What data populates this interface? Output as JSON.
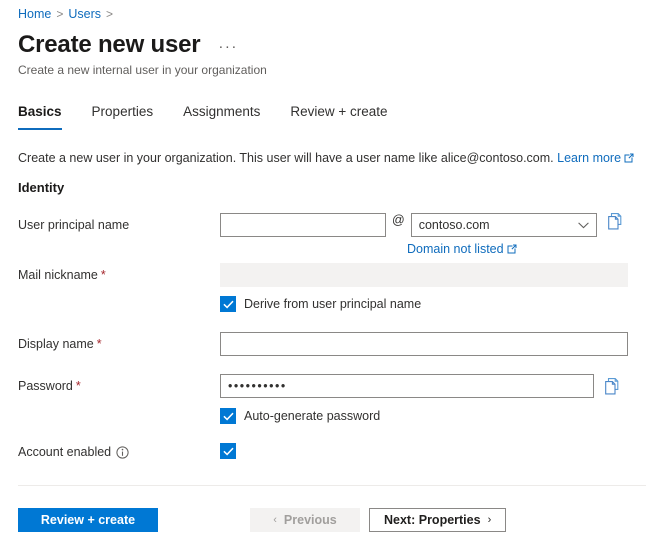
{
  "breadcrumb": {
    "items": [
      {
        "label": "Home"
      },
      {
        "label": "Users"
      }
    ],
    "separator": ">"
  },
  "header": {
    "title": "Create new user",
    "subtitle": "Create a new internal user in your organization",
    "more_menu": "···"
  },
  "tabs": [
    {
      "label": "Basics",
      "active": true
    },
    {
      "label": "Properties",
      "active": false
    },
    {
      "label": "Assignments",
      "active": false
    },
    {
      "label": "Review + create",
      "active": false
    }
  ],
  "intro": {
    "text": "Create a new user in your organization. This user will have a user name like alice@contoso.com.",
    "link_label": "Learn more",
    "link_icon": "external-link-icon"
  },
  "section": {
    "identity_heading": "Identity"
  },
  "fields": {
    "upn": {
      "label": "User principal name",
      "value": "",
      "placeholder": "",
      "at_sign": "@",
      "domain_value": "contoso.com",
      "domain_icon": "chevron-down-icon",
      "copy_icon": "copy-icon",
      "sublink_label": "Domain not listed",
      "sublink_icon": "external-link-icon"
    },
    "mail_nickname": {
      "label": "Mail nickname",
      "required": "*",
      "value": "",
      "disabled": true,
      "checkbox_label": "Derive from user principal name",
      "checkbox_checked": true
    },
    "display_name": {
      "label": "Display name",
      "required": "*",
      "value": "",
      "placeholder": ""
    },
    "password": {
      "label": "Password",
      "required": "*",
      "value": "••••••••••",
      "copy_icon": "copy-icon",
      "checkbox_label": "Auto-generate password",
      "checkbox_checked": true
    },
    "account_enabled": {
      "label": "Account enabled",
      "info_icon": "info-icon",
      "checkbox_checked": true
    }
  },
  "footer": {
    "review_create": "Review + create",
    "previous": "Previous",
    "previous_arrow": "‹",
    "next": "Next: Properties",
    "next_arrow": "›"
  },
  "colors": {
    "accent": "#0078d4",
    "link": "#0f6cbd",
    "required": "#a4262c",
    "disabled_bg": "#f3f2f1"
  }
}
